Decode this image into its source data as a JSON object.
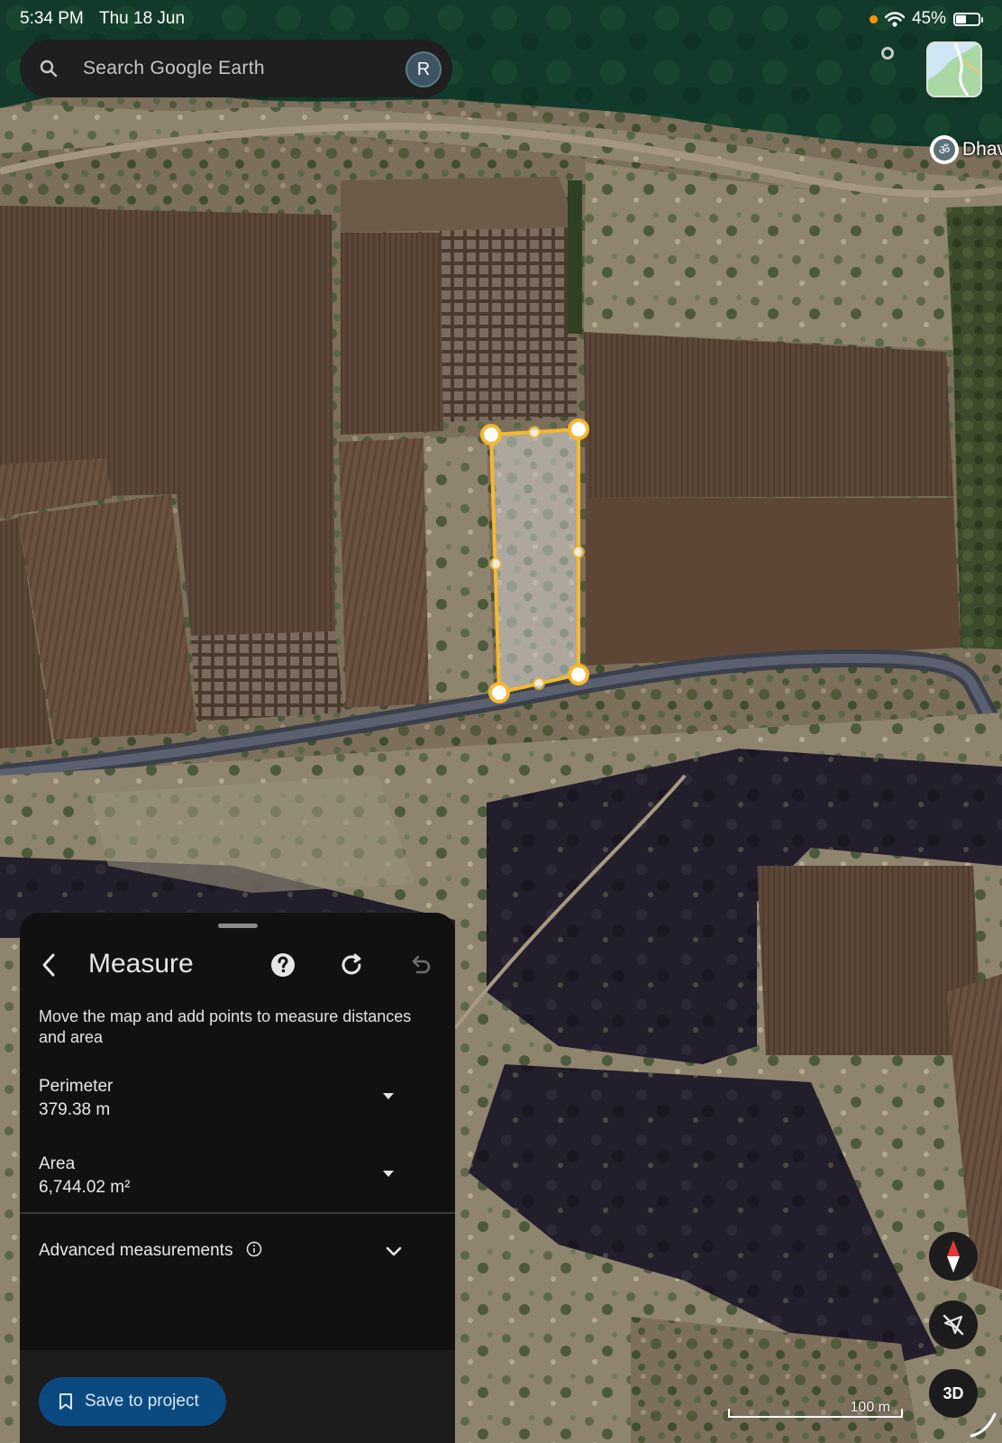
{
  "status_bar": {
    "time": "5:34 PM",
    "date": "Thu 18 Jun",
    "battery": "45%",
    "battery_level": 0.45
  },
  "search": {
    "placeholder": "Search Google Earth",
    "avatar_letter": "R"
  },
  "map": {
    "place_label": "Dhav",
    "place_icon": "om-icon",
    "polygon_color": "#f5b82e"
  },
  "measure_panel": {
    "title": "Measure",
    "instructions": "Move the map and add points to measure distances and area",
    "perimeter_label": "Perimeter",
    "perimeter_value": "379.38 m",
    "area_label": "Area",
    "area_value": "6,744.02 m²",
    "advanced_label": "Advanced measurements",
    "save_label": "Save to project"
  },
  "controls": {
    "threed_label": "3D",
    "scale_label": "100 m"
  },
  "colors": {
    "panel_bg": "#111111",
    "save_button": "#0b4a80",
    "accent_orange": "#ff9500"
  }
}
